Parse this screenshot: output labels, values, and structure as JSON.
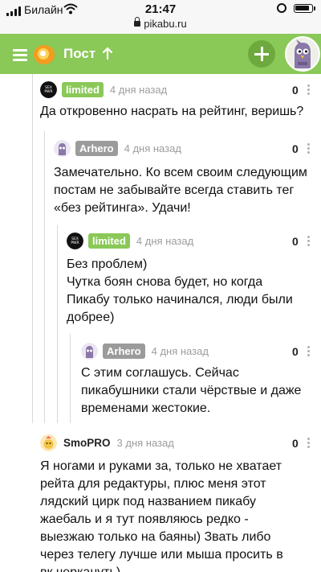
{
  "status_bar": {
    "carrier": "Билайн",
    "time": "21:47",
    "url": "pikabu.ru"
  },
  "header": {
    "title": "Пост",
    "icons": [
      "menu-icon",
      "pikabu-logo-icon",
      "arrow-up-icon",
      "plus-icon",
      "user-avatar"
    ],
    "accent_color": "#8ac858"
  },
  "comments": [
    {
      "author": "limited",
      "author_badge": "green",
      "date": "4 дня назад",
      "rating": "0",
      "text": "Да откровенно насрать на рейтинг, веришь?"
    },
    {
      "author": "Arhero",
      "author_badge": "gray",
      "date": "4 дня назад",
      "rating": "0",
      "text": "Замечательно. Ко всем своим следующим постам не забывайте всегда ставить тег «без рейтинга». Удачи!"
    },
    {
      "author": "limited",
      "author_badge": "green",
      "date": "4 дня назад",
      "rating": "0",
      "text": "Без проблем)\nЧутка боян снова будет, но когда Пикабу только начинался, люди были добрее)"
    },
    {
      "author": "Arhero",
      "author_badge": "gray",
      "date": "4 дня назад",
      "rating": "0",
      "text": "С этим соглашусь. Сейчас пикабушники стали чёрствые и даже временами жестокие."
    },
    {
      "author": "SmoPRO",
      "author_badge": "none",
      "date": "3 дня назад",
      "rating": "0",
      "text": "Я ногами и руками за, только не хватает рейта для редактуры, плюс меня этот лядский цирк под названием пикабу жаебаль и я тут появляюсь редко - выезжаю только на баяны) Звать либо через телегу лучше или мыша просить в вк черкануть)"
    }
  ]
}
